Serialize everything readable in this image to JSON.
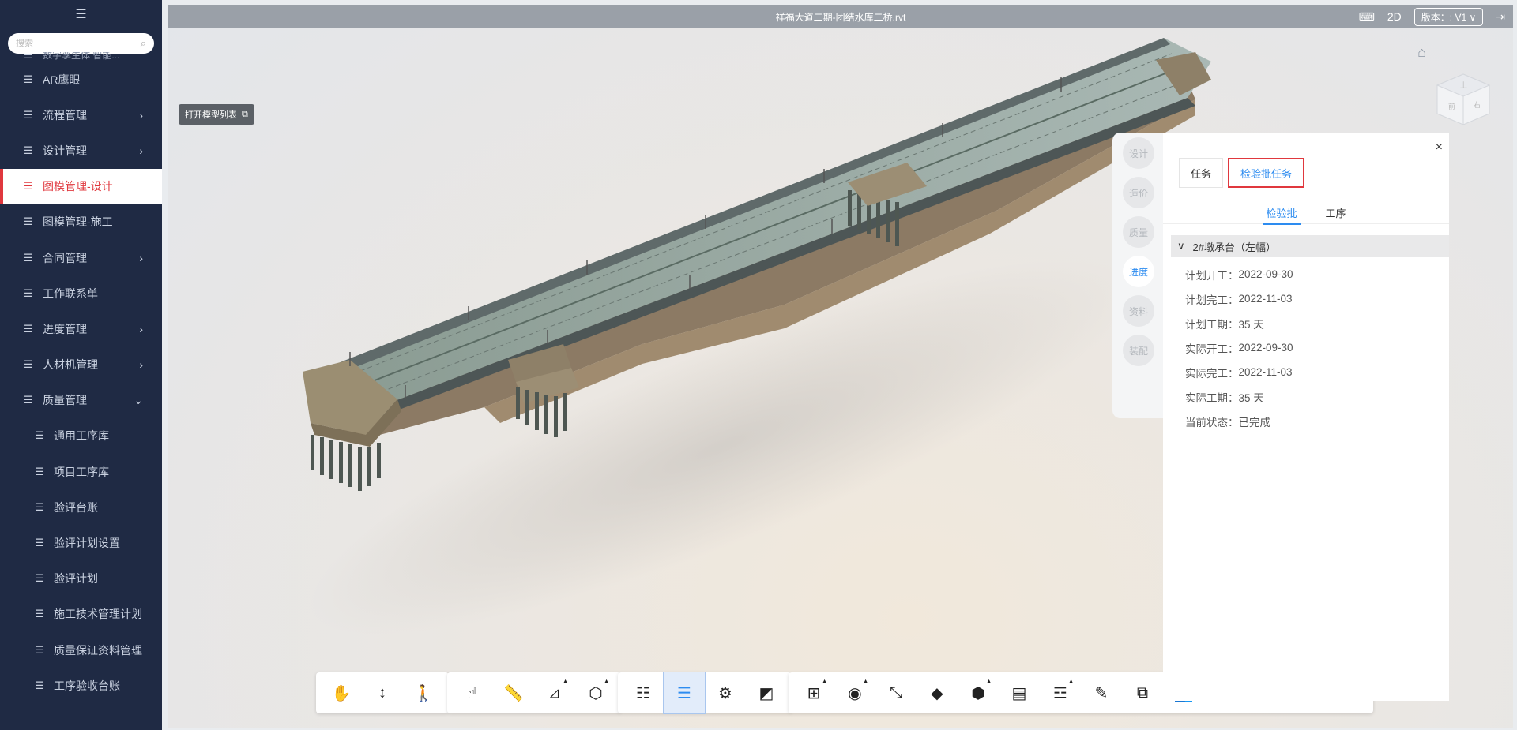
{
  "sidebar": {
    "collapse_icon": "menu-fold-icon",
    "search_placeholder": "搜索",
    "partial_item": "数字孪生体 智能...",
    "items": [
      {
        "label": "AR鹰眼",
        "arrow": ""
      },
      {
        "label": "流程管理",
        "arrow": "›"
      },
      {
        "label": "设计管理",
        "arrow": "›"
      },
      {
        "label": "图模管理-设计",
        "arrow": "",
        "active": true
      },
      {
        "label": "图模管理-施工",
        "arrow": ""
      },
      {
        "label": "合同管理",
        "arrow": "›"
      },
      {
        "label": "工作联系单",
        "arrow": ""
      },
      {
        "label": "进度管理",
        "arrow": "›"
      },
      {
        "label": "人材机管理",
        "arrow": "›"
      },
      {
        "label": "质量管理",
        "arrow": "⌄"
      },
      {
        "label": "通用工序库",
        "sub": true
      },
      {
        "label": "项目工序库",
        "sub": true
      },
      {
        "label": "验评台账",
        "sub": true
      },
      {
        "label": "验评计划设置",
        "sub": true
      },
      {
        "label": "验评计划",
        "sub": true
      },
      {
        "label": "施工技术管理计划",
        "sub": true
      },
      {
        "label": "质量保证资料管理",
        "sub": true
      },
      {
        "label": "工序验收台账",
        "sub": true
      }
    ]
  },
  "viewer": {
    "title": "祥福大道二期-团结水库二桥.rvt",
    "mode_2d": "2D",
    "version": "版本：: V1 ∨",
    "open_model_list": "打开模型列表",
    "viewcube_labels": [
      "前",
      "右",
      "上"
    ]
  },
  "panel": {
    "side_tabs": [
      "设计",
      "造价",
      "质量",
      "进度",
      "资料",
      "装配"
    ],
    "active_side_tab": "进度",
    "tabs": [
      "任务",
      "检验批任务"
    ],
    "subtabs": [
      "检验批",
      "工序"
    ],
    "group": "2#墩承台（左幅）",
    "close": "×",
    "fields": [
      {
        "label": "计划开工：",
        "value": "2022-09-30"
      },
      {
        "label": "计划完工：",
        "value": "2022-11-03"
      },
      {
        "label": "计划工期：",
        "value": "35 天"
      },
      {
        "label": "实际开工：",
        "value": "2022-09-30"
      },
      {
        "label": "实际完工：",
        "value": "2022-11-03"
      },
      {
        "label": "实际工期：",
        "value": "35 天"
      },
      {
        "label": "当前状态：",
        "value": "已完成"
      }
    ]
  },
  "toolbar": {
    "group1": [
      "pan-hand-icon",
      "vertical-move-icon",
      "person-walk-icon"
    ],
    "group2": [
      "rotate-hand-icon",
      "measure-ruler-icon",
      "section-plane-icon",
      "box-section-icon"
    ],
    "group3": [
      "model-tree-icon",
      "properties-icon",
      "settings-icon",
      "layer-icon"
    ],
    "group4": [
      "view-manage-icon",
      "visibility-icon",
      "zoom-fit-icon",
      "paint-bucket-icon",
      "component-icon",
      "document-icon",
      "filter-icon",
      "markup-icon",
      "copy-icon",
      "team-icon",
      "shield-icon",
      "share-icon",
      "shield-box-icon",
      "parts-icon"
    ]
  },
  "colors": {
    "accent": "#2d8cf0",
    "active_red": "#e0383e",
    "sidebar_bg": "#1f2a44"
  }
}
